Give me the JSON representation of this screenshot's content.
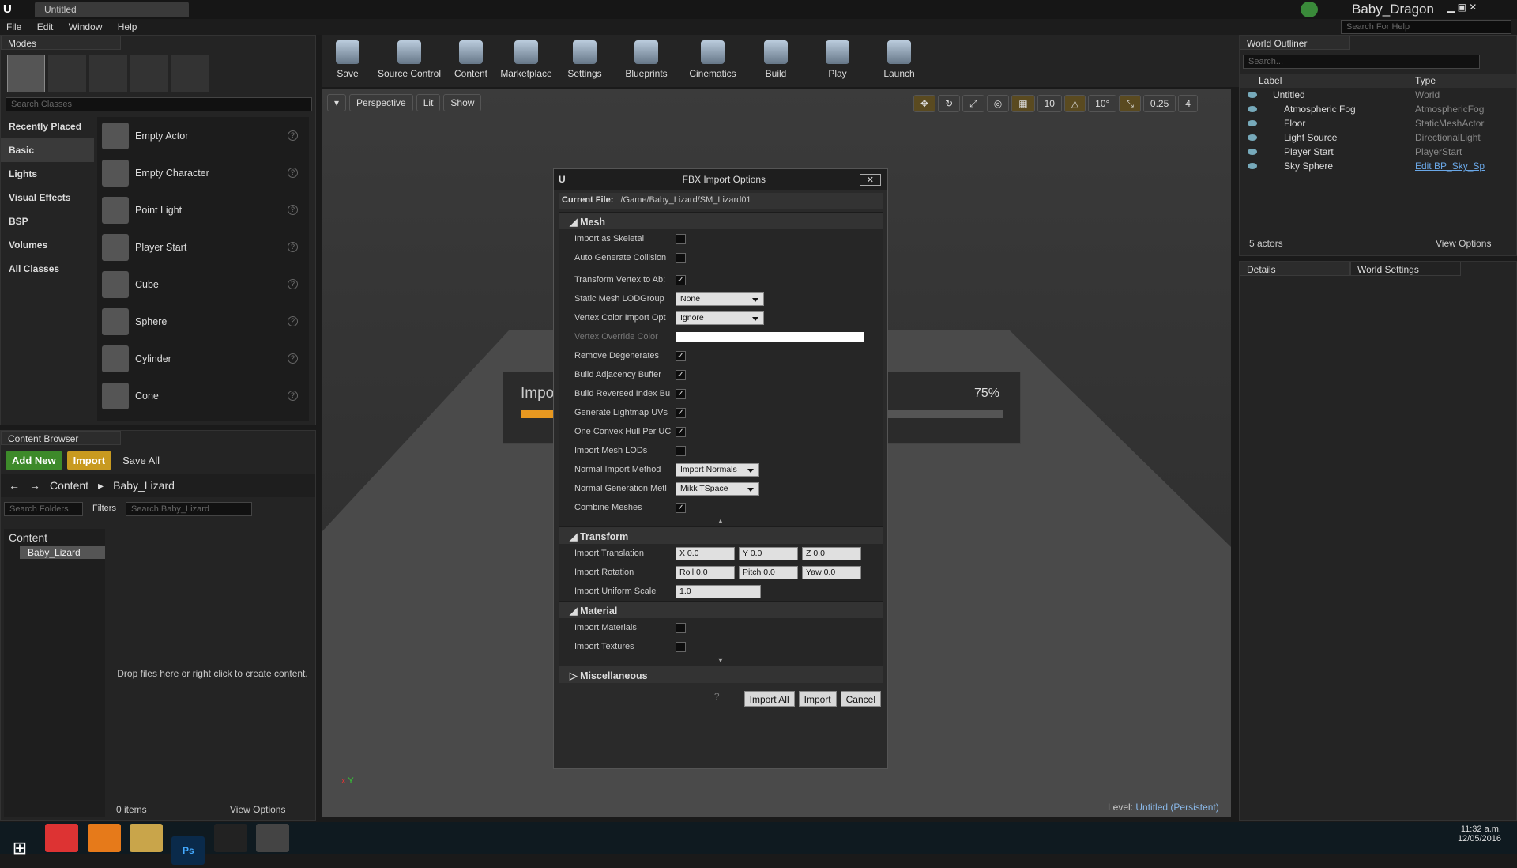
{
  "window": {
    "tab": "Untitled",
    "user": "Baby_Dragon",
    "help_placeholder": "Search For Help"
  },
  "menu": [
    "File",
    "Edit",
    "Window",
    "Help"
  ],
  "modes": {
    "tab": "Modes",
    "search_placeholder": "Search Classes",
    "categories": [
      "Recently Placed",
      "Basic",
      "Lights",
      "Visual Effects",
      "BSP",
      "Volumes",
      "All Classes"
    ],
    "items": [
      "Empty Actor",
      "Empty Character",
      "Point Light",
      "Player Start",
      "Cube",
      "Sphere",
      "Cylinder",
      "Cone"
    ]
  },
  "toolbar": [
    "Save",
    "Source Control",
    "Content",
    "Marketplace",
    "Settings",
    "Blueprints",
    "Cinematics",
    "Build",
    "Play",
    "Launch"
  ],
  "viewport": {
    "perspective": "Perspective",
    "lit": "Lit",
    "show": "Show",
    "grid_snap": "10",
    "rot_snap": "10°",
    "scale_snap": "0.25",
    "cam_speed": "4",
    "level_label": "Level:",
    "level_name": "Untitled (Persistent)",
    "progress_label": "Impo",
    "progress_pct": "75%",
    "progress_value": 0.75
  },
  "content_browser": {
    "tab": "Content Browser",
    "add_new": "Add New",
    "import": "Import",
    "save_all": "Save All",
    "path_root": "Content",
    "path_sub": "Baby_Lizard",
    "search_folders": "Search Folders",
    "filters": "Filters",
    "search_assets": "Search Baby_Lizard",
    "tree_root": "Content",
    "tree_child": "Baby_Lizard",
    "empty_msg": "Drop files here or right click to create content.",
    "items_count": "0 items",
    "view_options": "View Options"
  },
  "outliner": {
    "tab": "World Outliner",
    "search": "Search...",
    "col_label": "Label",
    "col_type": "Type",
    "rows": [
      {
        "label": "Untitled",
        "type": "World"
      },
      {
        "label": "Atmospheric Fog",
        "type": "AtmosphericFog"
      },
      {
        "label": "Floor",
        "type": "StaticMeshActor"
      },
      {
        "label": "Light Source",
        "type": "DirectionalLight"
      },
      {
        "label": "Player Start",
        "type": "PlayerStart"
      },
      {
        "label": "Sky Sphere",
        "type": "Edit BP_Sky_Sp"
      }
    ],
    "count": "5 actors",
    "view_options": "View Options"
  },
  "details": {
    "tab1": "Details",
    "tab2": "World Settings"
  },
  "dialog": {
    "title": "FBX Import Options",
    "current_file_label": "Current File:",
    "current_file": "/Game/Baby_Lizard/SM_Lizard01",
    "mesh_header": "Mesh",
    "mesh_rows": [
      {
        "label": "Import as Skeletal",
        "checked": false
      },
      {
        "label": "Auto Generate Collision",
        "checked": false
      },
      {
        "label": "Transform Vertex to Ab:",
        "checked": true
      },
      {
        "label": "Static Mesh LODGroup",
        "combo": "None"
      },
      {
        "label": "Vertex Color Import Opt",
        "combo": "Ignore"
      },
      {
        "label": "Vertex Override Color",
        "color": "#ffffff"
      },
      {
        "label": "Remove Degenerates",
        "checked": true
      },
      {
        "label": "Build Adjacency Buffer",
        "checked": true
      },
      {
        "label": "Build Reversed Index Bu",
        "checked": true
      },
      {
        "label": "Generate Lightmap UVs",
        "checked": true
      },
      {
        "label": "One Convex Hull Per UC",
        "checked": true
      },
      {
        "label": "Import Mesh LODs",
        "checked": false
      },
      {
        "label": "Normal Import Method",
        "combo": "Import Normals"
      },
      {
        "label": "Normal Generation Metl",
        "combo": "Mikk TSpace"
      },
      {
        "label": "Combine Meshes",
        "checked": true
      }
    ],
    "transform_header": "Transform",
    "translation_label": "Import Translation",
    "translation": [
      "X  0.0",
      "Y  0.0",
      "Z  0.0"
    ],
    "rotation_label": "Import Rotation",
    "rotation": [
      "Roll  0.0",
      "Pitch  0.0",
      "Yaw  0.0"
    ],
    "scale_label": "Import Uniform Scale",
    "scale": "1.0",
    "material_header": "Material",
    "material_rows": [
      {
        "label": "Import Materials",
        "checked": false
      },
      {
        "label": "Import Textures",
        "checked": false
      }
    ],
    "misc_header": "Miscellaneous",
    "btn_import_all": "Import All",
    "btn_import": "Import",
    "btn_cancel": "Cancel"
  },
  "taskbar": {
    "time": "11:32 a.m.",
    "date": "12/05/2016"
  }
}
